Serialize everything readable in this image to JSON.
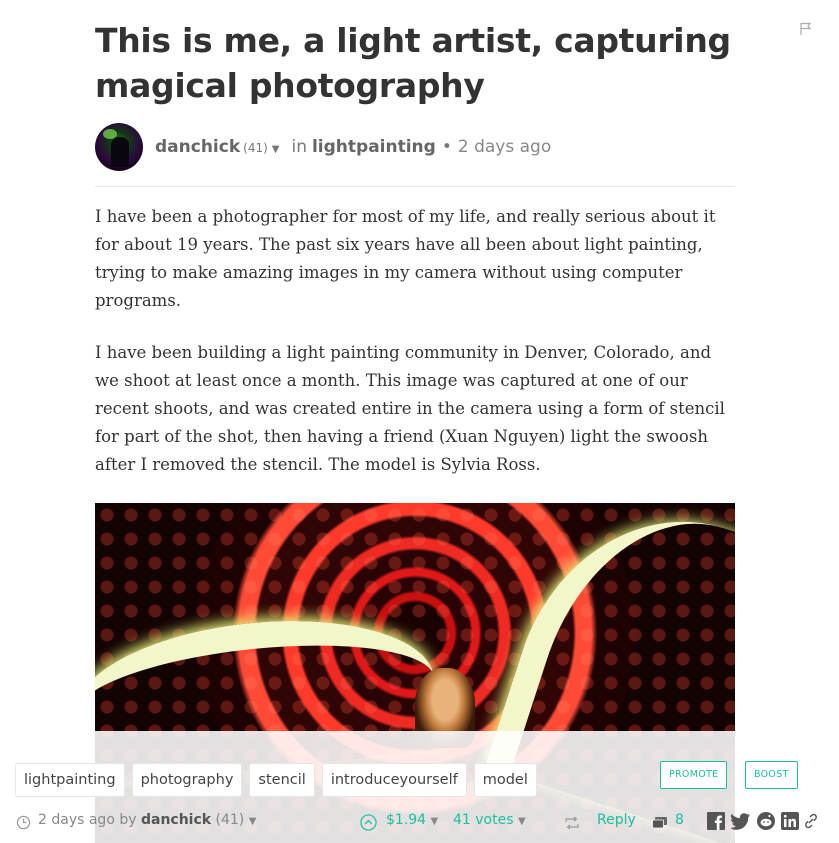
{
  "post": {
    "title": "This is me, a light artist, capturing magical photography",
    "author": "danchick",
    "reputation": "(41)",
    "in_label": "in",
    "category": "lightpainting",
    "separator": "•",
    "time": "2 days ago",
    "paragraphs": [
      "I have been a photographer for most of my life, and really serious about it for about 19 years. The past six years have all been about light painting, trying to make amazing images in my camera without using computer programs.",
      "I have been building a light painting community in Denver, Colorado, and we shoot at least once a month. This image was captured at one of our recent shoots, and was created entire in the camera using a form of stencil for part of the shot, then having a friend (Xuan Nguyen) light the swoosh after I removed the stencil. The model is Sylvia Ross."
    ]
  },
  "tags": [
    "lightpainting",
    "photography",
    "stencil",
    "introduceyourself",
    "model"
  ],
  "actions": {
    "promote_label": "PROMOTE",
    "boost_label": "BOOST"
  },
  "footer": {
    "time": "2 days ago",
    "by_label": "by",
    "author": "danchick",
    "reputation": "(41)",
    "payout": "$1.94",
    "votes": "41 votes",
    "reply_label": "Reply",
    "comment_count": "8"
  },
  "colors": {
    "accent": "#1bbfa0",
    "text": "#333333",
    "muted": "#888888"
  },
  "icons": [
    "flag-icon",
    "chevron-down-icon",
    "clock-icon",
    "upvote-icon",
    "reblog-icon",
    "comments-icon",
    "facebook-icon",
    "twitter-icon",
    "reddit-icon",
    "linkedin-icon",
    "link-icon"
  ]
}
